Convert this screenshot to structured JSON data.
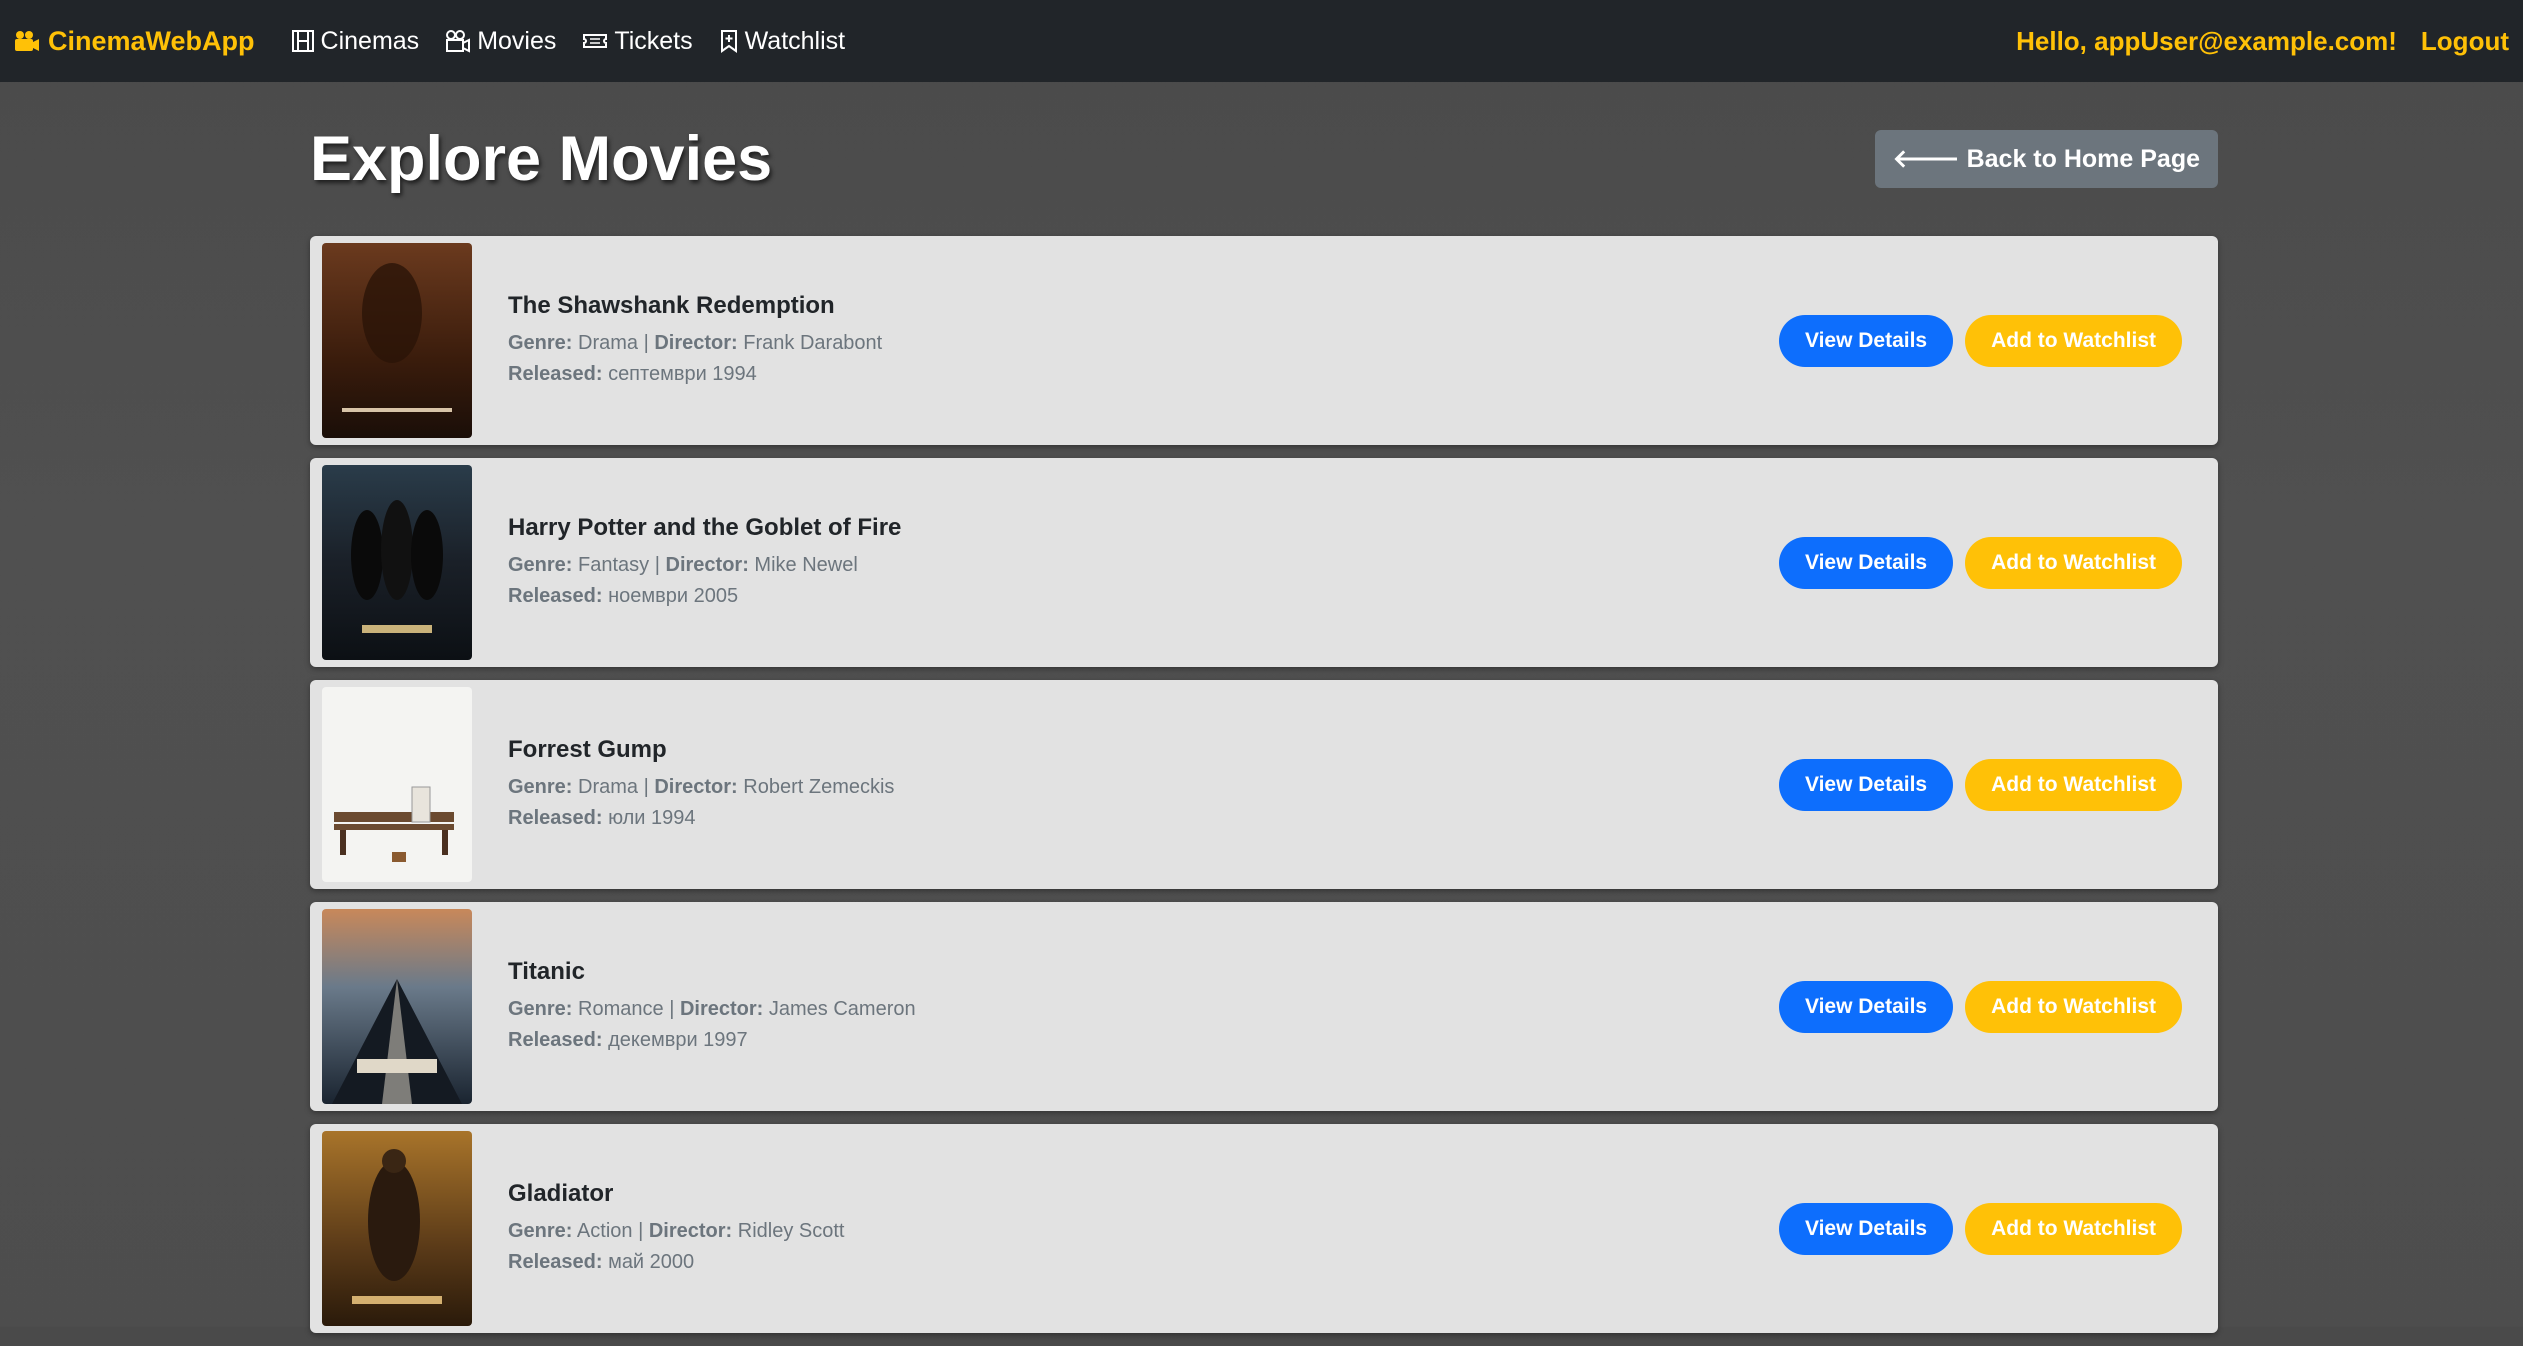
{
  "nav": {
    "brand": "CinemaWebApp",
    "links": [
      "Cinemas",
      "Movies",
      "Tickets",
      "Watchlist"
    ],
    "greeting": "Hello, appUser@example.com!",
    "logout": "Logout"
  },
  "page": {
    "title": "Explore Movies",
    "back_button": "🡐 Back to Home Page"
  },
  "labels": {
    "genre": "Genre:",
    "separator": " | ",
    "director": "Director:",
    "released": "Released:",
    "view_details": "View Details",
    "add_watchlist": "Add to Watchlist"
  },
  "movies": [
    {
      "title": "The Shawshank Redemption",
      "genre": "Drama",
      "director": "Frank Darabont",
      "released": "септември 1994"
    },
    {
      "title": "Harry Potter and the Goblet of Fire",
      "genre": "Fantasy",
      "director": "Mike Newel",
      "released": "ноември 2005"
    },
    {
      "title": "Forrest Gump",
      "genre": "Drama",
      "director": "Robert Zemeckis",
      "released": "юли 1994"
    },
    {
      "title": "Titanic",
      "genre": "Romance",
      "director": "James Cameron",
      "released": "декември 1997"
    },
    {
      "title": "Gladiator",
      "genre": "Action",
      "director": "Ridley Scott",
      "released": "май 2000"
    }
  ]
}
